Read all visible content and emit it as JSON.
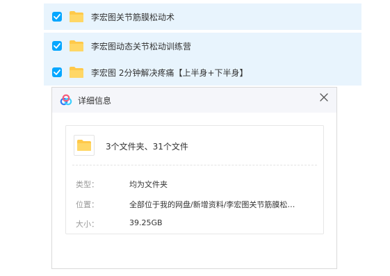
{
  "file_list": {
    "items": [
      {
        "name": "李宏图关节筋膜松动术",
        "checked": true
      },
      {
        "name": "李宏图动态关节松动训练营",
        "checked": true
      },
      {
        "name": "李宏图 2分钟解决疼痛【上半身+下半身】",
        "checked": true
      }
    ]
  },
  "dialog": {
    "title": "详细信息",
    "summary": "3个文件夹、31个文件",
    "fields": {
      "type_label": "类型：",
      "type_value": "均为文件夹",
      "location_label": "位置：",
      "location_value": "全部位于我的网盘/新增资料/李宏图关节筋膜松…",
      "size_label": "大小：",
      "size_value": "39.25GB"
    }
  },
  "colors": {
    "row_bg": "#e8f4fd",
    "checkbox_blue": "#06a7ff",
    "folder_yellow": "#ffc94a",
    "dialog_header_bg": "#f5f6fa"
  },
  "icons": {
    "checkbox": "checkbox-checked-icon",
    "folder": "folder-icon",
    "logo": "baidu-netdisk-logo-icon",
    "close": "close-icon"
  }
}
